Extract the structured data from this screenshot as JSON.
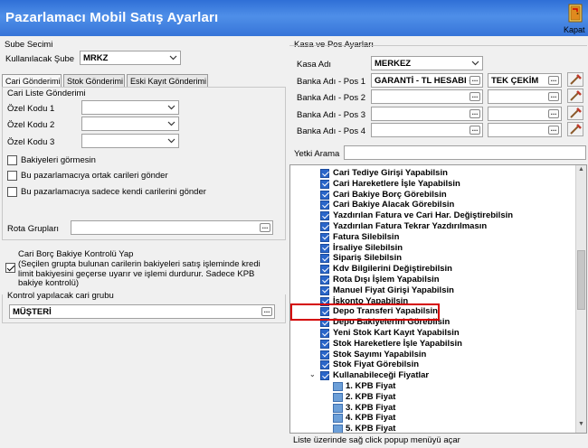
{
  "window": {
    "title": "Pazarlamacı Mobil Satış Ayarları",
    "close_label": "Kapat"
  },
  "sube": {
    "group_title": "Sube Secimi",
    "label": "Kullanılacak Şube",
    "value": "MRKZ"
  },
  "tabs": [
    {
      "label": "Cari Gönderimi"
    },
    {
      "label": "Stok Gönderimi"
    },
    {
      "label": "Eski Kayıt Gönderimi"
    }
  ],
  "cari": {
    "group_title": "Cari Liste Gönderimi",
    "ozel_kodlar": [
      {
        "label": "Özel Kodu 1",
        "value": ""
      },
      {
        "label": "Özel Kodu 2",
        "value": ""
      },
      {
        "label": "Özel Kodu 3",
        "value": ""
      }
    ],
    "checkboxes": [
      {
        "label": "Bakiyeleri görmesin",
        "checked": false
      },
      {
        "label": "Bu pazarlamacıya ortak carileri gönder",
        "checked": false
      },
      {
        "label": "Bu pazarlamacıya sadece kendi carilerini gönder",
        "checked": false
      }
    ],
    "rota_label": "Rota Grupları",
    "rota_value": "",
    "borc_bakiye_lines": [
      "Cari Borç Bakiye Kontrolü Yap",
      "(Seçilen grupta bulunan carilerin bakiyeleri satış işleminde kredi",
      "limit bakiyesini geçerse uyarır ve işlemi durdurur. Sadece KPB",
      "bakiye kontrolü)"
    ],
    "borc_bakiye_checked": true,
    "kontrol_title": "Kontrol yapılacak cari grubu",
    "kontrol_value": "MÜŞTERİ"
  },
  "kasa_pos": {
    "group_title": "Kasa ve Pos Ayarları",
    "kasa_label": "Kasa Adı",
    "kasa_value": "MERKEZ",
    "pos_rows": [
      {
        "label": "Banka Adı - Pos 1",
        "bank": "GARANTİ - TL HESABI -",
        "cekim": "TEK ÇEKİM"
      },
      {
        "label": "Banka Adı - Pos 2",
        "bank": "",
        "cekim": ""
      },
      {
        "label": "Banka Adı - Pos 3",
        "bank": "",
        "cekim": ""
      },
      {
        "label": "Banka Adı - Pos 4",
        "bank": "",
        "cekim": ""
      }
    ]
  },
  "yetki": {
    "search_label": "Yetki Arama",
    "search_value": ""
  },
  "tree": {
    "items": [
      {
        "label": "Cari Tediye Girişi Yapabilsin",
        "indent": 0,
        "checked": true,
        "kind": "check"
      },
      {
        "label": "Cari Hareketlere İşle Yapabilsin",
        "indent": 0,
        "checked": true,
        "kind": "check"
      },
      {
        "label": "Cari Bakiye Borç Görebilsin",
        "indent": 0,
        "checked": true,
        "kind": "check"
      },
      {
        "label": "Cari Bakiye Alacak Görebilsin",
        "indent": 0,
        "checked": true,
        "kind": "check"
      },
      {
        "label": "Yazdırılan Fatura ve Cari Har. Değiştirebilsin",
        "indent": 0,
        "checked": true,
        "kind": "check"
      },
      {
        "label": "Yazdırılan Fatura Tekrar Yazdırılmasın",
        "indent": 0,
        "checked": true,
        "kind": "check"
      },
      {
        "label": "Fatura Silebilsin",
        "indent": 0,
        "checked": true,
        "kind": "check"
      },
      {
        "label": "İrsaliye Silebilsin",
        "indent": 0,
        "checked": true,
        "kind": "check"
      },
      {
        "label": "Sipariş Silebilsin",
        "indent": 0,
        "checked": true,
        "kind": "check"
      },
      {
        "label": "Kdv Bilgilerini Değiştirebilsin",
        "indent": 0,
        "checked": true,
        "kind": "check"
      },
      {
        "label": "Rota Dışı İşlem Yapabilsin",
        "indent": 0,
        "checked": true,
        "kind": "check"
      },
      {
        "label": "Manuel Fiyat Girişi Yapabilsin",
        "indent": 0,
        "checked": true,
        "kind": "check"
      },
      {
        "label": "İskonto Yapabilsin",
        "indent": 0,
        "checked": true,
        "kind": "check"
      },
      {
        "label": "Depo Transferi Yapabilsin",
        "indent": 0,
        "checked": true,
        "kind": "check"
      },
      {
        "label": "Depo Bakiyelerini Görebilsin",
        "indent": 0,
        "checked": true,
        "kind": "check"
      },
      {
        "label": "Yeni Stok Kart Kayıt Yapabilsin",
        "indent": 0,
        "checked": true,
        "kind": "check"
      },
      {
        "label": "Stok Hareketlere İşle Yapabilsin",
        "indent": 0,
        "checked": true,
        "kind": "check"
      },
      {
        "label": "Stok Sayımı Yapabilsin",
        "indent": 0,
        "checked": true,
        "kind": "check"
      },
      {
        "label": "Stok Fiyat Görebilsin",
        "indent": 0,
        "checked": true,
        "kind": "check"
      },
      {
        "label": "Kullanabileceği Fiyatlar",
        "indent": 0,
        "checked": true,
        "kind": "group"
      },
      {
        "label": "1. KPB Fiyat",
        "indent": 1,
        "checked": false,
        "kind": "leaf"
      },
      {
        "label": "2. KPB Fiyat",
        "indent": 1,
        "checked": false,
        "kind": "leaf"
      },
      {
        "label": "3. KPB Fiyat",
        "indent": 1,
        "checked": false,
        "kind": "leaf"
      },
      {
        "label": "4. KPB Fiyat",
        "indent": 1,
        "checked": false,
        "kind": "leaf"
      },
      {
        "label": "5. KPB Fiyat",
        "indent": 1,
        "checked": false,
        "kind": "leaf"
      }
    ],
    "highlighted_index": 13
  },
  "status": {
    "text": "Liste üzerinde sağ click popup menüyü açar"
  },
  "colors": {
    "title_gradient_top": "#2f6fd6",
    "title_gradient_bottom": "#3674d8",
    "checkbox_blue": "#2a66c9",
    "highlight_red": "#d40000"
  }
}
